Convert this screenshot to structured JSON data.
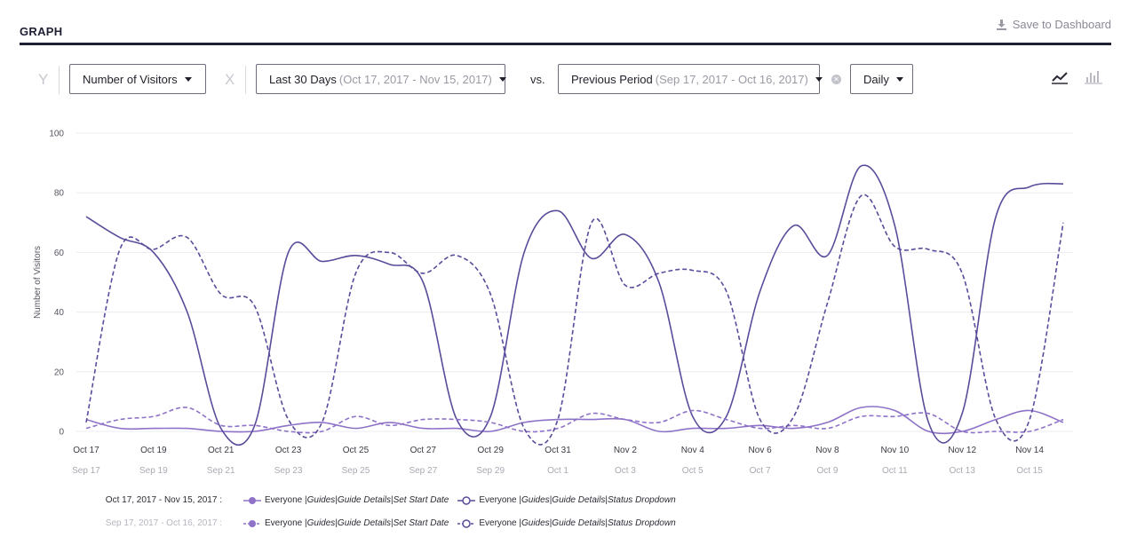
{
  "header": {
    "title": "GRAPH",
    "save_label": "Save to Dashboard"
  },
  "toolbar": {
    "y_letter": "Y",
    "x_letter": "X",
    "metric_label": "Number of Visitors",
    "range_label": "Last 30 Days",
    "range_detail": "(Oct 17, 2017 - Nov 15, 2017)",
    "vs_label": "vs.",
    "compare_label": "Previous Period",
    "compare_detail": "(Sep 17, 2017 - Oct 16, 2017)",
    "interval_label": "Daily"
  },
  "colors": {
    "primary": "#5b4b9a",
    "secondary": "#8e72c8",
    "grid": "#ececf0",
    "muted": "#a9a9b3"
  },
  "chart_data": {
    "type": "line",
    "ylabel": "Number of Visitors",
    "ylim": [
      0,
      100
    ],
    "yticks": [
      0,
      20,
      40,
      60,
      80,
      100
    ],
    "x_tick_labels": [
      "Oct 17",
      "Oct 19",
      "Oct 21",
      "Oct 23",
      "Oct 25",
      "Oct 27",
      "Oct 29",
      "Oct 31",
      "Nov 2",
      "Nov 4",
      "Nov 6",
      "Nov 8",
      "Nov 10",
      "Nov 12",
      "Nov 14"
    ],
    "x_tick_labels_previous": [
      "Sep 17",
      "Sep 19",
      "Sep 21",
      "Sep 23",
      "Sep 25",
      "Sep 27",
      "Sep 29",
      "Oct 1",
      "Oct 3",
      "Oct 5",
      "Oct 7",
      "Oct 9",
      "Oct 11",
      "Oct 13",
      "Oct 15"
    ],
    "grid": true,
    "series": [
      {
        "name": "Everyone | Guides | Guide Details | Set Start Date",
        "period": "current",
        "style": "solid",
        "color": "#8e72c8",
        "values": [
          4,
          1,
          1,
          1,
          0,
          0,
          2,
          3,
          1,
          3,
          1,
          1,
          0,
          3,
          4,
          4,
          4,
          0,
          1,
          1,
          2,
          1,
          3,
          8,
          7,
          0,
          0,
          4,
          7,
          3
        ]
      },
      {
        "name": "Everyone | Guides | Guide Details | Status Dropdown",
        "period": "current",
        "style": "solid",
        "color": "#5b4b9a",
        "values": [
          72,
          65,
          60,
          40,
          1,
          2,
          60,
          57,
          59,
          56,
          50,
          4,
          5,
          60,
          74,
          58,
          66,
          50,
          5,
          5,
          47,
          69,
          59,
          89,
          69,
          3,
          6,
          72,
          82,
          83
        ]
      },
      {
        "name": "Everyone | Guides | Guide Details | Set Start Date",
        "period": "previous",
        "style": "dashed",
        "color": "#8e72c8",
        "values": [
          1,
          4,
          5,
          8,
          2,
          2,
          0,
          0,
          5,
          2,
          4,
          4,
          3,
          0,
          1,
          6,
          4,
          3,
          7,
          4,
          1,
          2,
          1,
          5,
          5,
          6,
          0,
          0,
          0,
          4
        ]
      },
      {
        "name": "Everyone | Guides | Guide Details | Status Dropdown",
        "period": "previous",
        "style": "dashed",
        "color": "#5b4b9a",
        "values": [
          3,
          61,
          61,
          65,
          46,
          42,
          4,
          3,
          53,
          60,
          53,
          59,
          46,
          1,
          4,
          70,
          49,
          53,
          54,
          47,
          4,
          5,
          43,
          79,
          62,
          61,
          53,
          4,
          4,
          70
        ]
      }
    ]
  },
  "legend": {
    "current_period": "Oct 17, 2017 - Nov 15, 2017 :",
    "previous_period": "Sep 17, 2017 - Oct 16, 2017 :",
    "item_a_prefix": "Everyone | ",
    "item_a_guides": "Guides",
    "item_a_sep": " | ",
    "item_a_details": "Guide Details",
    "item_a_sep2": " | ",
    "item_a_name": "Set Start Date",
    "item_b_prefix": "Everyone | ",
    "item_b_guides": "Guides",
    "item_b_sep": " | ",
    "item_b_details": "Guide Details",
    "item_b_sep2": " | ",
    "item_b_name": "Status Dropdown"
  }
}
